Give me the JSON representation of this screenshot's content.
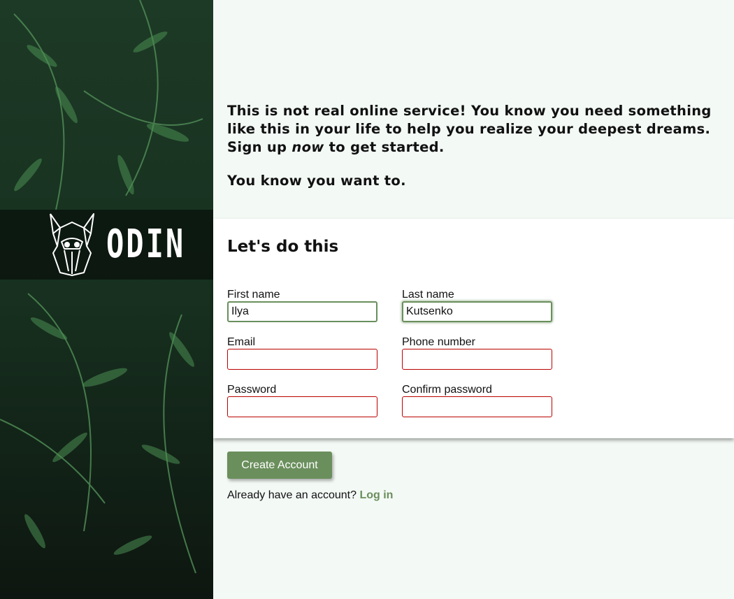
{
  "brand": {
    "logo_text": "ODIN"
  },
  "intro": {
    "line1_before": "This is not real online service! You know you need something like this in your life to help you realize your deepest dreams. Sign up ",
    "line1_emphasis": "now",
    "line1_after": " to get started.",
    "line2": "You know you want to."
  },
  "form": {
    "heading": "Let's do this",
    "fields": {
      "first_name": {
        "label": "First name",
        "value": "Ilya"
      },
      "last_name": {
        "label": "Last name",
        "value": "Kutsenko"
      },
      "email": {
        "label": "Email",
        "value": ""
      },
      "phone": {
        "label": "Phone number",
        "value": ""
      },
      "password": {
        "label": "Password",
        "value": ""
      },
      "confirm_password": {
        "label": "Confirm password",
        "value": ""
      }
    }
  },
  "actions": {
    "create_label": "Create Account",
    "login_prompt": "Already have an account?",
    "login_link": "Log in"
  },
  "colors": {
    "accent": "#6a8f5c",
    "invalid_border": "#bb0000",
    "page_bg": "#f3f9f5"
  }
}
